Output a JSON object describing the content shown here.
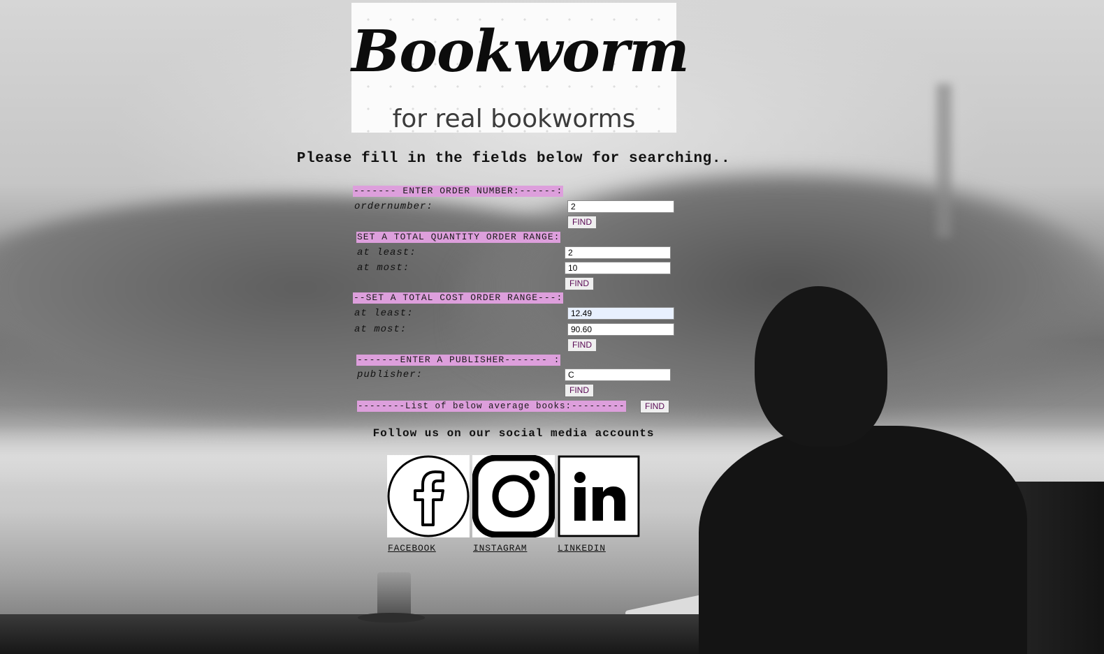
{
  "logo": {
    "title": "Bookworm",
    "tagline": "for real bookworms"
  },
  "heading": "Please fill in the fields below for searching..",
  "order_section": {
    "band": "------- ENTER ORDER NUMBER:------:",
    "label": "ordernumber:",
    "value": "2",
    "button": "FIND"
  },
  "quantity_section": {
    "band": "SET A TOTAL QUANTITY ORDER RANGE:",
    "least_label": "at least:",
    "least_value": "2",
    "most_label": "at most:",
    "most_value": "10",
    "button": "FIND"
  },
  "cost_section": {
    "band": "--SET A TOTAL COST ORDER RANGE---:",
    "least_label": "at least:",
    "least_value": "12.49",
    "most_label": "at most:",
    "most_value": "90.60",
    "button": "FIND"
  },
  "publisher_section": {
    "band": "-------ENTER A PUBLISHER------- :",
    "label": "publisher:",
    "value": "C",
    "button": "FIND"
  },
  "below_average": {
    "band": "--------List of below average books:---------",
    "button": "FIND"
  },
  "follow_text": "Follow us on our social media accounts",
  "social": [
    {
      "name": "facebook-icon",
      "label": "FACEBOOK"
    },
    {
      "name": "instagram-icon",
      "label": "INSTAGRAM"
    },
    {
      "name": "linkedin-icon",
      "label": "LINKEDIN"
    }
  ],
  "colors": {
    "band": "#dd9fdc",
    "button_text": "#5a0a55",
    "focus_field": "#e8f0fe"
  }
}
